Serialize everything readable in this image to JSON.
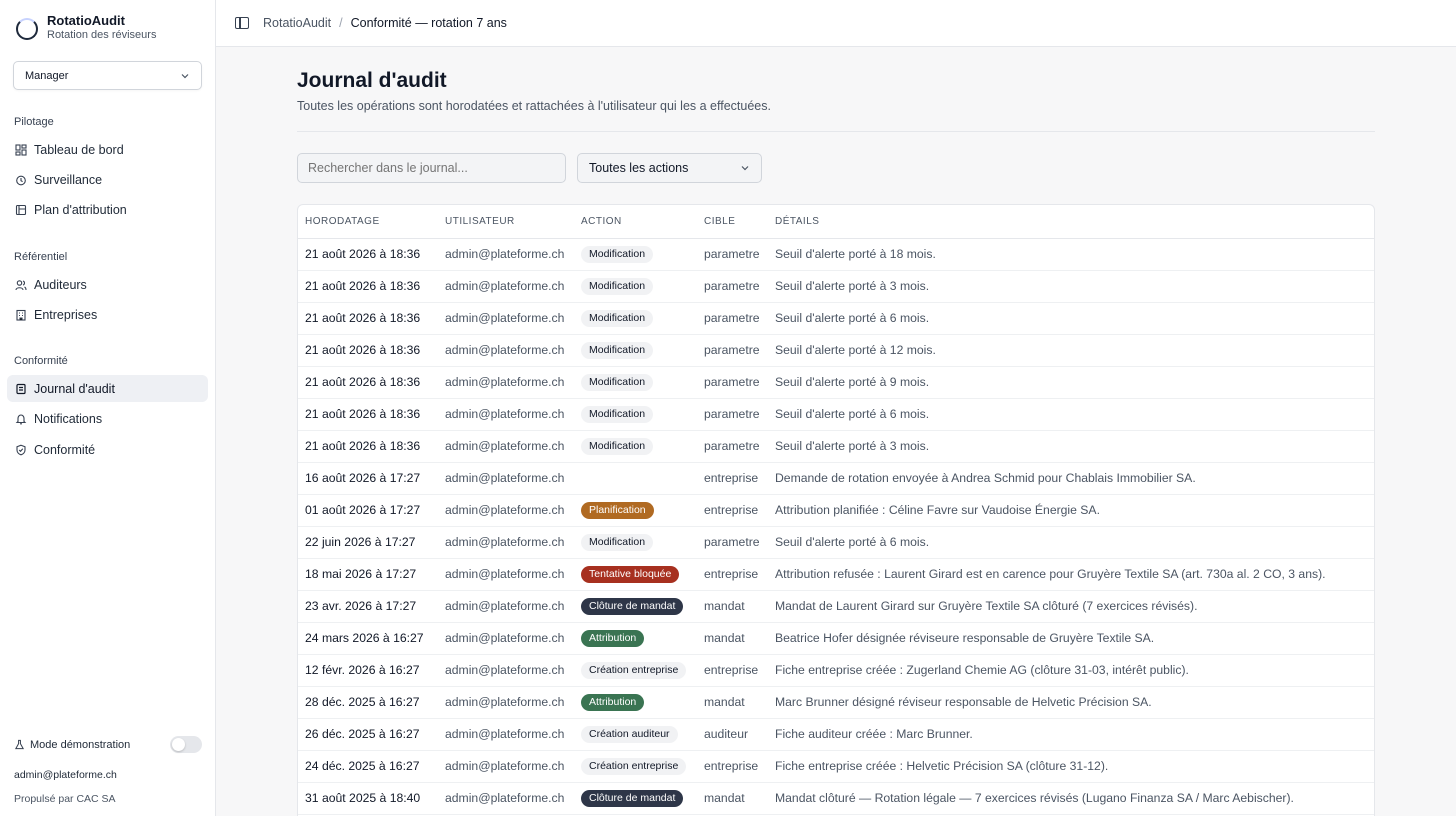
{
  "app": {
    "name": "RotatioAudit",
    "subtitle": "Rotation des réviseurs"
  },
  "role_select": {
    "value": "Manager"
  },
  "sidebar": {
    "sections": [
      {
        "label": "Pilotage",
        "items": [
          {
            "label": "Tableau de bord",
            "icon": "dashboard-icon"
          },
          {
            "label": "Surveillance",
            "icon": "alarm-clock-icon"
          },
          {
            "label": "Plan d'attribution",
            "icon": "calendar-plan-icon"
          }
        ]
      },
      {
        "label": "Référentiel",
        "items": [
          {
            "label": "Auditeurs",
            "icon": "users-icon"
          },
          {
            "label": "Entreprises",
            "icon": "building-icon"
          }
        ]
      },
      {
        "label": "Conformité",
        "items": [
          {
            "label": "Journal d'audit",
            "icon": "scroll-icon",
            "active": true
          },
          {
            "label": "Notifications",
            "icon": "bell-icon"
          },
          {
            "label": "Conformité",
            "icon": "shield-check-icon"
          }
        ]
      }
    ],
    "demo_mode_label": "Mode démonstration",
    "demo_mode_on": false,
    "user_email": "admin@plateforme.ch",
    "powered_by": "Propulsé par CAC SA"
  },
  "breadcrumb": {
    "root": "RotatioAudit",
    "current": "Conformité — rotation 7 ans"
  },
  "page": {
    "title": "Journal d'audit",
    "subtitle": "Toutes les opérations sont horodatées et rattachées à l'utilisateur qui les a effectuées.",
    "search_placeholder": "Rechercher dans le journal...",
    "action_filter": "Toutes les actions"
  },
  "table": {
    "columns": [
      "Horodatage",
      "Utilisateur",
      "Action",
      "Cible",
      "Détails"
    ],
    "rows": [
      {
        "ts": "21 août 2026 à 18:36",
        "user": "admin@plateforme.ch",
        "action": "Modification",
        "kind": "modif",
        "target": "parametre",
        "details": "Seuil d'alerte porté à 18 mois."
      },
      {
        "ts": "21 août 2026 à 18:36",
        "user": "admin@plateforme.ch",
        "action": "Modification",
        "kind": "modif",
        "target": "parametre",
        "details": "Seuil d'alerte porté à 3 mois."
      },
      {
        "ts": "21 août 2026 à 18:36",
        "user": "admin@plateforme.ch",
        "action": "Modification",
        "kind": "modif",
        "target": "parametre",
        "details": "Seuil d'alerte porté à 6 mois."
      },
      {
        "ts": "21 août 2026 à 18:36",
        "user": "admin@plateforme.ch",
        "action": "Modification",
        "kind": "modif",
        "target": "parametre",
        "details": "Seuil d'alerte porté à 12 mois."
      },
      {
        "ts": "21 août 2026 à 18:36",
        "user": "admin@plateforme.ch",
        "action": "Modification",
        "kind": "modif",
        "target": "parametre",
        "details": "Seuil d'alerte porté à 9 mois."
      },
      {
        "ts": "21 août 2026 à 18:36",
        "user": "admin@plateforme.ch",
        "action": "Modification",
        "kind": "modif",
        "target": "parametre",
        "details": "Seuil d'alerte porté à 6 mois."
      },
      {
        "ts": "21 août 2026 à 18:36",
        "user": "admin@plateforme.ch",
        "action": "Modification",
        "kind": "modif",
        "target": "parametre",
        "details": "Seuil d'alerte porté à 3 mois."
      },
      {
        "ts": "16 août 2026 à 17:27",
        "user": "admin@plateforme.ch",
        "action": "",
        "kind": "none",
        "target": "entreprise",
        "details": "Demande de rotation envoyée à Andrea Schmid pour Chablais Immobilier SA."
      },
      {
        "ts": "01 août 2026 à 17:27",
        "user": "admin@plateforme.ch",
        "action": "Planification",
        "kind": "plan",
        "target": "entreprise",
        "details": "Attribution planifiée : Céline Favre sur Vaudoise Énergie SA."
      },
      {
        "ts": "22 juin 2026 à 17:27",
        "user": "admin@plateforme.ch",
        "action": "Modification",
        "kind": "modif",
        "target": "parametre",
        "details": "Seuil d'alerte porté à 6 mois."
      },
      {
        "ts": "18 mai 2026 à 17:27",
        "user": "admin@plateforme.ch",
        "action": "Tentative bloquée",
        "kind": "block",
        "target": "entreprise",
        "details": "Attribution refusée : Laurent Girard est en carence pour Gruyère Textile SA (art. 730a al. 2 CO, 3 ans)."
      },
      {
        "ts": "23 avr. 2026 à 17:27",
        "user": "admin@plateforme.ch",
        "action": "Clôture de mandat",
        "kind": "close",
        "target": "mandat",
        "details": "Mandat de Laurent Girard sur Gruyère Textile SA clôturé (7 exercices révisés)."
      },
      {
        "ts": "24 mars 2026 à 16:27",
        "user": "admin@plateforme.ch",
        "action": "Attribution",
        "kind": "attr",
        "target": "mandat",
        "details": "Beatrice Hofer désignée réviseure responsable de Gruyère Textile SA."
      },
      {
        "ts": "12 févr. 2026 à 16:27",
        "user": "admin@plateforme.ch",
        "action": "Création entreprise",
        "kind": "create",
        "target": "entreprise",
        "details": "Fiche entreprise créée : Zugerland Chemie AG (clôture 31-03, intérêt public)."
      },
      {
        "ts": "28 déc. 2025 à 16:27",
        "user": "admin@plateforme.ch",
        "action": "Attribution",
        "kind": "attr",
        "target": "mandat",
        "details": "Marc Brunner désigné réviseur responsable de Helvetic Précision SA."
      },
      {
        "ts": "26 déc. 2025 à 16:27",
        "user": "admin@plateforme.ch",
        "action": "Création auditeur",
        "kind": "create",
        "target": "auditeur",
        "details": "Fiche auditeur créée : Marc Brunner."
      },
      {
        "ts": "24 déc. 2025 à 16:27",
        "user": "admin@plateforme.ch",
        "action": "Création entreprise",
        "kind": "create",
        "target": "entreprise",
        "details": "Fiche entreprise créée : Helvetic Précision SA (clôture 31-12)."
      },
      {
        "ts": "31 août 2025 à 18:40",
        "user": "admin@plateforme.ch",
        "action": "Clôture de mandat",
        "kind": "close",
        "target": "mandat",
        "details": "Mandat clôturé — Rotation légale — 7 exercices révisés (Lugano Finanza SA / Marc Aebischer)."
      }
    ]
  }
}
